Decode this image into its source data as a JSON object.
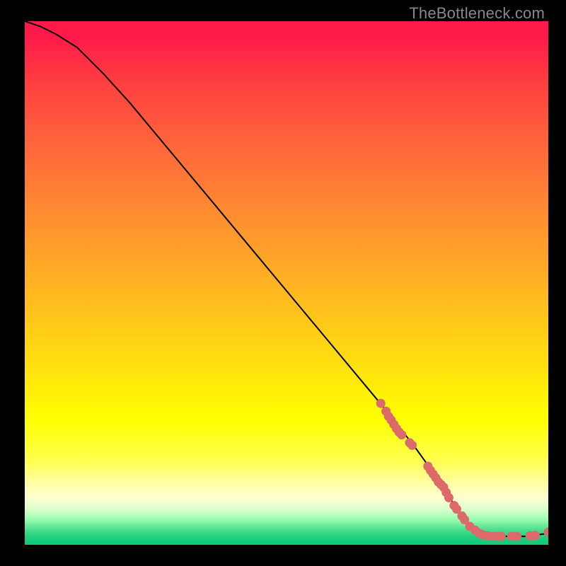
{
  "attribution": "TheBottleneck.com",
  "chart_data": {
    "type": "line",
    "title": "",
    "xlabel": "",
    "ylabel": "",
    "xlim": [
      0,
      100
    ],
    "ylim": [
      0,
      100
    ],
    "grid": false,
    "curve": {
      "x": [
        0,
        3,
        6,
        10,
        15,
        20,
        25,
        30,
        35,
        40,
        45,
        50,
        55,
        60,
        65,
        70,
        75,
        80,
        83,
        85,
        88,
        92,
        96,
        100
      ],
      "y": [
        100,
        99,
        97.5,
        95,
        90,
        84.5,
        78.5,
        72.5,
        66.5,
        60.5,
        54.5,
        48.5,
        42.5,
        36.5,
        30.5,
        24.5,
        18,
        11,
        6,
        3.5,
        2,
        1.6,
        1.6,
        2.2
      ]
    },
    "marker_series": {
      "color": "#dd6a6a",
      "points": [
        {
          "x": 68,
          "y": 27
        },
        {
          "x": 69,
          "y": 25.5
        },
        {
          "x": 69.5,
          "y": 24.5
        },
        {
          "x": 70,
          "y": 23.8
        },
        {
          "x": 70.5,
          "y": 23
        },
        {
          "x": 71,
          "y": 22.2
        },
        {
          "x": 71.5,
          "y": 21.5
        },
        {
          "x": 72,
          "y": 21
        },
        {
          "x": 73.5,
          "y": 19.5
        },
        {
          "x": 74,
          "y": 19
        },
        {
          "x": 77,
          "y": 15
        },
        {
          "x": 77.5,
          "y": 14.2
        },
        {
          "x": 78,
          "y": 13.5
        },
        {
          "x": 78.5,
          "y": 12.8
        },
        {
          "x": 79,
          "y": 12
        },
        {
          "x": 79.5,
          "y": 11.5
        },
        {
          "x": 80,
          "y": 11
        },
        {
          "x": 80.5,
          "y": 10
        },
        {
          "x": 81,
          "y": 9
        },
        {
          "x": 82,
          "y": 7.5
        },
        {
          "x": 82.5,
          "y": 6.8
        },
        {
          "x": 83.5,
          "y": 5.5
        },
        {
          "x": 84,
          "y": 4.8
        },
        {
          "x": 85,
          "y": 3.5
        },
        {
          "x": 86,
          "y": 2.8
        },
        {
          "x": 86.8,
          "y": 2.2
        },
        {
          "x": 87.5,
          "y": 1.9
        },
        {
          "x": 88.5,
          "y": 1.7
        },
        {
          "x": 89.5,
          "y": 1.6
        },
        {
          "x": 90.5,
          "y": 1.6
        },
        {
          "x": 91,
          "y": 1.6
        },
        {
          "x": 93,
          "y": 1.6
        },
        {
          "x": 94,
          "y": 1.6
        },
        {
          "x": 96.5,
          "y": 1.7
        },
        {
          "x": 97.5,
          "y": 1.8
        },
        {
          "x": 100,
          "y": 2.4
        }
      ]
    }
  }
}
